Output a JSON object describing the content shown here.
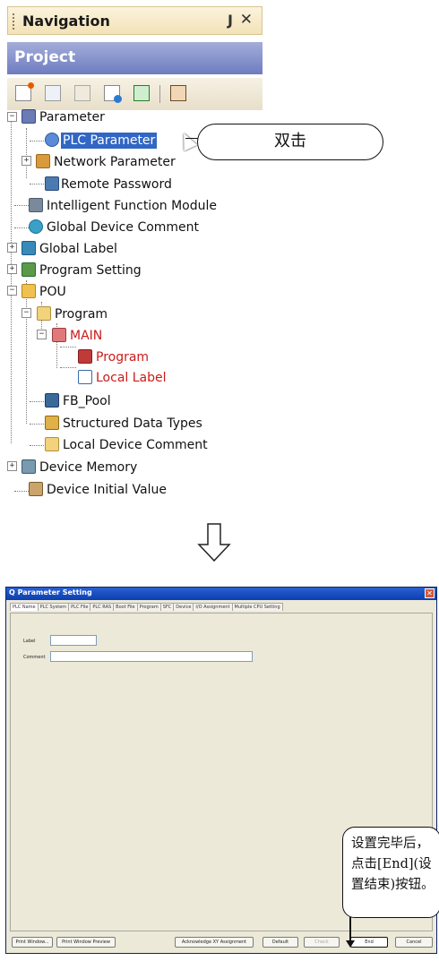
{
  "navigation": {
    "title": "Navigation",
    "pin_glyph": "Ԅ",
    "close_glyph": "✕",
    "project_header": "Project",
    "toolbar_icons": [
      "new-item-icon",
      "copy-icon",
      "paste-icon",
      "property-icon",
      "refresh-icon",
      "fb-icon"
    ],
    "tree": {
      "parameter": "Parameter",
      "plc_parameter": "PLC Parameter",
      "network_parameter": "Network Parameter",
      "remote_password": "Remote Password",
      "intelligent_function_module": "Intelligent Function Module",
      "global_device_comment": "Global Device Comment",
      "global_label": "Global Label",
      "program_setting": "Program Setting",
      "pou": "POU",
      "program": "Program",
      "main": "MAIN",
      "main_program": "Program",
      "main_local_label": "Local Label",
      "fb_pool": "FB_Pool",
      "structured_data_types": "Structured Data Types",
      "local_device_comment": "Local Device Comment",
      "device_memory": "Device Memory",
      "device_initial_value": "Device Initial Value"
    }
  },
  "annotations": {
    "double_click": "双击",
    "end_hint": "设置完毕后，点击[End](设置结束)按钮。"
  },
  "dialog": {
    "title": "Q Parameter Setting",
    "tabs": [
      "PLC Name",
      "PLC System",
      "PLC File",
      "PLC RAS",
      "Boot File",
      "Program",
      "SFC",
      "Device",
      "I/O Assignment",
      "Multiple CPU Setting"
    ],
    "label_field": "Label",
    "comment_field": "Comment",
    "buttons": {
      "print_window": "Print Window...",
      "print_window_preview": "Print Window Preview",
      "acknowledge": "Acknowledge XY Assignment",
      "default": "Default",
      "check": "Check",
      "end": "End",
      "cancel": "Cancel"
    }
  },
  "colors": {
    "selected": "#3166c5",
    "red_text": "#cc1a1a",
    "project_header": "#8791cb",
    "dialog_title": "#1f52c2"
  }
}
